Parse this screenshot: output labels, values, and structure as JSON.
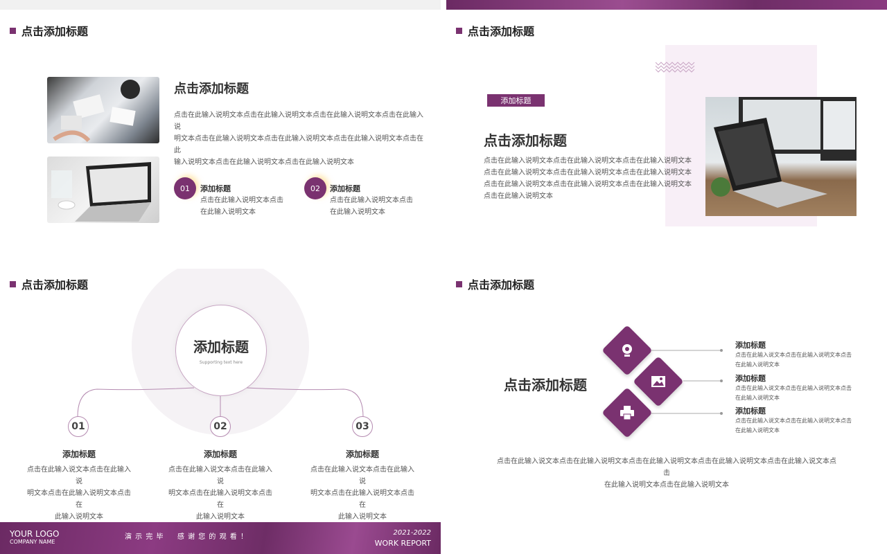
{
  "colors": {
    "accent": "#7a3270",
    "light_bg": "#f7eef6"
  },
  "p1": {
    "section_title": "点击添加标题",
    "heading": "点击添加标题",
    "body_lines": [
      "点击在此输入说明文本点击在此输入说明文本点击在此输入说明文本点击在此输入说",
      "明文本点击在此输入说明文本点击在此输入说明文本点击在此输入说明文本点击在此",
      "输入说明文本点击在此输入说明文本点击在此输入说明文本"
    ],
    "items": [
      {
        "num": "01",
        "title": "添加标题",
        "lines": [
          "点击在此输入说明文本点击",
          "在此输入说明文本"
        ]
      },
      {
        "num": "02",
        "title": "添加标题",
        "lines": [
          "点击在此输入说明文本点击",
          "在此输入说明文本"
        ]
      }
    ],
    "photo_icons": [
      "meeting-photo-icon",
      "laptop-photo-icon"
    ]
  },
  "p2": {
    "section_title": "点击添加标题",
    "tag": "添加标题",
    "heading": "点击添加标题",
    "body_lines": [
      "点击在此输入说明文本点击在此输入说明文本点击在此输入说明文本",
      "点击在此输入说明文本点击在此输入说明文本点击在此输入说明文本",
      "点击在此输入说明文本点击在此输入说明文本点击在此输入说明文本",
      "点击在此输入说明文本"
    ]
  },
  "p3": {
    "section_title": "点击添加标题",
    "center_title": "添加标题",
    "center_sub": "Supporting text here",
    "items": [
      {
        "num": "01",
        "title": "添加标题",
        "lines": [
          "点击在此输入说文本点击在此输入说",
          "明文本点击在此输入说明文本点击在",
          "此输入说明文本"
        ]
      },
      {
        "num": "02",
        "title": "添加标题",
        "lines": [
          "点击在此输入说文本点击在此输入说",
          "明文本点击在此输入说明文本点击在",
          "此输入说明文本"
        ]
      },
      {
        "num": "03",
        "title": "添加标题",
        "lines": [
          "点击在此输入说文本点击在此输入说",
          "明文本点击在此输入说明文本点击在",
          "此输入说明文本"
        ]
      }
    ]
  },
  "p4": {
    "section_title": "点击添加标题",
    "heading": "点击添加标题",
    "items": [
      {
        "title": "添加标题",
        "lines": [
          "点击在此输入说文本点击在此输入说明文本点击",
          "在此输入说明文本"
        ],
        "icon": "webcam-icon"
      },
      {
        "title": "添加标题",
        "lines": [
          "点击在此输入说文本点击在此输入说明文本点击",
          "在此输入说明文本"
        ],
        "icon": "image-icon"
      },
      {
        "title": "添加标题",
        "lines": [
          "点击在此输入说文本点击在此输入说明文本点击",
          "在此输入说明文本"
        ],
        "icon": "printer-icon"
      }
    ],
    "bottom_lines": [
      "点击在此输入说文本点击在此输入说明文本点击在此输入说明文本点击在此输入说明文本点击在此输入说文本点击",
      "在此输入说明文本点击在此输入说明文本"
    ]
  },
  "footer": {
    "logo": "YOUR LOGO",
    "company": "COMPANY NAME",
    "thanks": "演 示 完 毕 　 感 谢 您 的 观 看 ！",
    "years": "2021-2022",
    "report": "WORK REPORT"
  }
}
